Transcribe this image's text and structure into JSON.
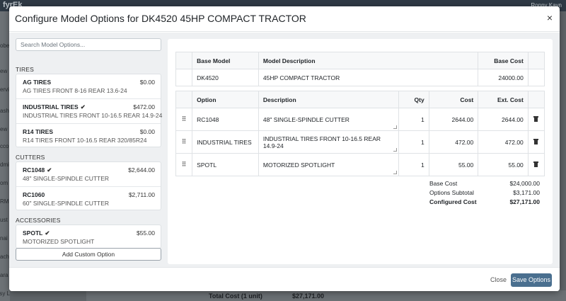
{
  "background": {
    "logo": "fyrEk",
    "user": "Ronny Kayn",
    "sidebar_items": [
      "obe",
      "ew",
      "ervi",
      "ash",
      "ew",
      "cco",
      "dmi",
      "om",
      "RM",
      "ust",
      "nai",
      "ach",
      "ara",
      "sy L"
    ],
    "total_label": "Total Cost (1 unit)",
    "total_value": "$27,171.00"
  },
  "modal": {
    "title": "Configure Model Options for DK4520 45HP COMPACT TRACTOR",
    "close_glyph": "×",
    "search_placeholder": "Search Model Options...",
    "groups": [
      {
        "label": "TIRES",
        "options": [
          {
            "name": "AG TIRES",
            "selected": false,
            "price": "$0.00",
            "desc": "AG TIRES FRONT 8-16 REAR 13.6-24"
          },
          {
            "name": "INDUSTRIAL TIRES",
            "selected": true,
            "price": "$472.00",
            "desc": "INDUSTRIAL TIRES FRONT 10-16.5 REAR 14.9-24"
          },
          {
            "name": "R14 TIRES",
            "selected": false,
            "price": "$0.00",
            "desc": "R14 TIRES FRONT 10-16.5 REAR 320/85R24"
          }
        ]
      },
      {
        "label": "CUTTERS",
        "options": [
          {
            "name": "RC1048",
            "selected": true,
            "price": "$2,644.00",
            "desc": "48\" SINGLE-SPINDLE CUTTER"
          },
          {
            "name": "RC1060",
            "selected": false,
            "price": "$2,711.00",
            "desc": "60\" SINGLE-SPINDLE CUTTER"
          }
        ]
      },
      {
        "label": "ACCESSORIES",
        "options": [
          {
            "name": "SPOTL",
            "selected": true,
            "price": "$55.00",
            "desc": "MOTORIZED SPOTLIGHT"
          }
        ]
      }
    ],
    "add_custom_label": "Add Custom Option",
    "base_table": {
      "headers": [
        "Base Model",
        "Model Description",
        "Base Cost"
      ],
      "row": {
        "model": "DK4520",
        "description": "45HP COMPACT TRACTOR",
        "cost": "24000.00"
      }
    },
    "options_table": {
      "headers": [
        "Option",
        "Description",
        "Qty",
        "Cost",
        "Ext. Cost"
      ],
      "rows": [
        {
          "option": "RC1048",
          "description": "48\" SINGLE-SPINDLE CUTTER",
          "qty": "1",
          "cost": "2644.00",
          "ext": "2644.00"
        },
        {
          "option": "INDUSTRIAL TIRES",
          "description": "INDUSTRIAL TIRES FRONT 10-16.5 REAR 14.9-24",
          "qty": "1",
          "cost": "472.00",
          "ext": "472.00"
        },
        {
          "option": "SPOTL",
          "description": "MOTORIZED SPOTLIGHT",
          "qty": "1",
          "cost": "55.00",
          "ext": "55.00"
        }
      ]
    },
    "summary": {
      "base_label": "Base Cost",
      "base_value": "$24,000.00",
      "subtotal_label": "Options Subtotal",
      "subtotal_value": "$3,171.00",
      "configured_label": "Configured Cost",
      "configured_value": "$27,171.00"
    },
    "footer": {
      "close_label": "Close",
      "save_label": "Save Options"
    }
  },
  "icons": {
    "drag_handle": "⠿",
    "check": "✔"
  }
}
